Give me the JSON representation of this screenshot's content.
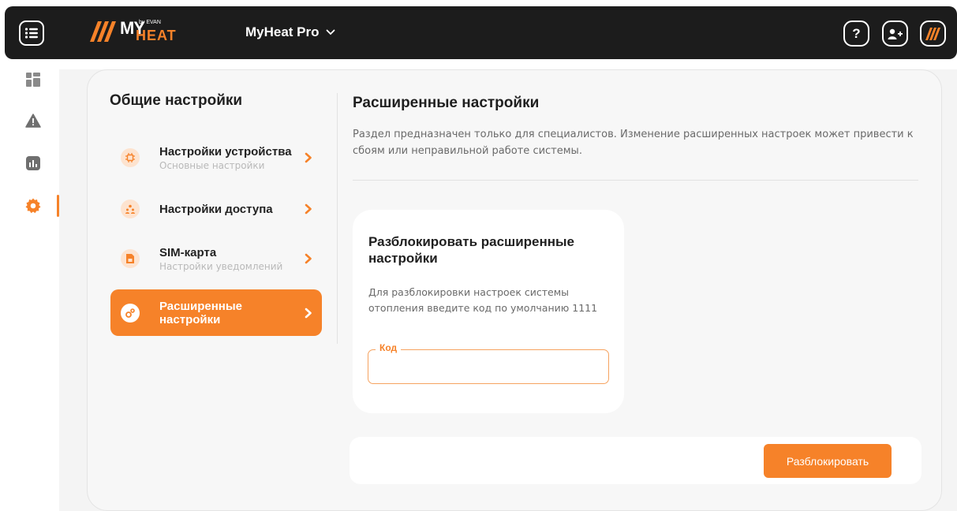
{
  "header": {
    "brand_my": "MY",
    "brand_heat": "HEAT",
    "brand_by": "by EVAN",
    "device_name": "MyHeat Pro",
    "help_label": "?",
    "accent": "#f68229"
  },
  "rail": {
    "items": [
      {
        "icon": "dashboard-icon"
      },
      {
        "icon": "alert-icon"
      },
      {
        "icon": "chart-icon"
      },
      {
        "icon": "gear-icon",
        "active": true
      }
    ]
  },
  "sidebar": {
    "title": "Общие настройки",
    "items": [
      {
        "label": "Настройки устройства",
        "sub": "Основные настройки",
        "icon": "chip-icon"
      },
      {
        "label": "Настройки доступа",
        "sub": "",
        "icon": "users-icon"
      },
      {
        "label": "SIM-карта",
        "sub": "Настройки уведомлений",
        "icon": "sim-icon"
      },
      {
        "label": "Расширенные настройки",
        "sub": "",
        "icon": "gears-icon",
        "active": true
      }
    ]
  },
  "main": {
    "title": "Расширенные настройки",
    "description": "Раздел предназначен только для специалистов. Изменение расширенных настроек может привести к сбоям или неправильной работе системы.",
    "unlock": {
      "title": "Разблокировать расширенные настройки",
      "hint": "Для разблокировки настроек системы отопления введите код по умолчанию 1111",
      "field_label": "Код",
      "field_value": "",
      "button_label": "Разблокировать"
    }
  }
}
